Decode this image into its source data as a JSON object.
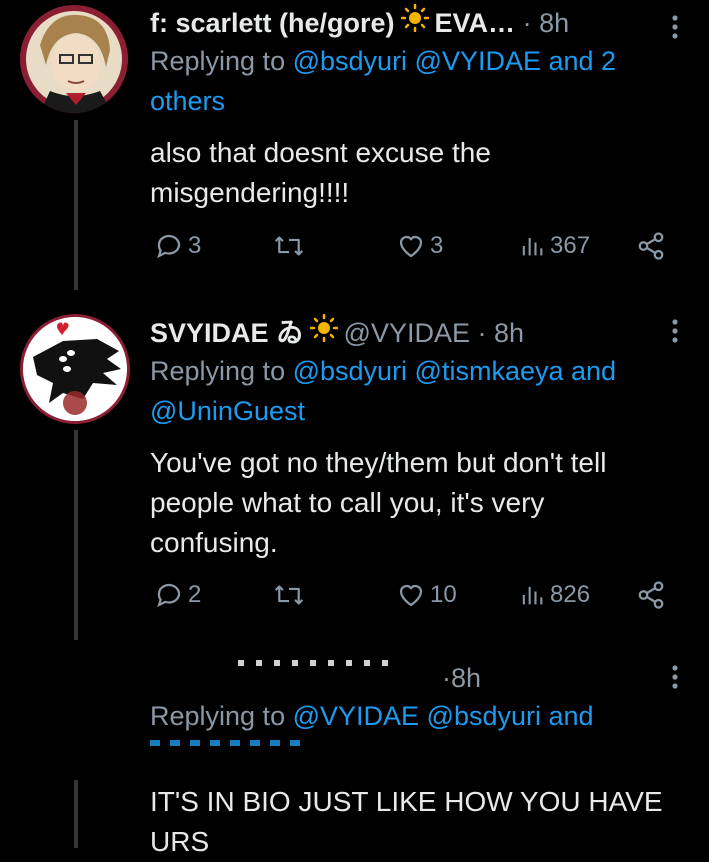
{
  "tweets": [
    {
      "name": "f: scarlett (he/gore)",
      "name_suffix": "EVA…",
      "handle": "",
      "time": "8h",
      "replying_prefix": "Replying to",
      "replying_mentions": "@bsdyuri @VYIDAE and 2",
      "replying_mentions_2": "others",
      "text_lines": [
        "also that doesnt excuse the",
        "misgendering!!!!"
      ],
      "replies": "3",
      "likes": "3",
      "views": "367"
    },
    {
      "name": "SVYIDAE",
      "name_glyph": "ゐ",
      "handle": "@VYIDAE",
      "time": "8h",
      "replying_prefix": "Replying to",
      "replying_mentions": "@bsdyuri @tismkaeya and",
      "replying_mentions_2": "@UninGuest",
      "text_lines": [
        "You've got no they/them but don't tell",
        "people what to call you, it's very",
        "confusing."
      ],
      "replies": "2",
      "likes": "10",
      "views": "826"
    },
    {
      "time": "8h",
      "replying_prefix": "Replying to",
      "replying_mentions": "@VYIDAE @bsdyuri and",
      "text_lines": [
        "IT'S IN BIO JUST LIKE HOW YOU HAVE",
        "URS"
      ]
    }
  ],
  "colors": {
    "background": "#000000",
    "text": "#e7e9ea",
    "muted": "#8b98a5",
    "link": "#1d9bf0",
    "sun": "#f4b400"
  }
}
